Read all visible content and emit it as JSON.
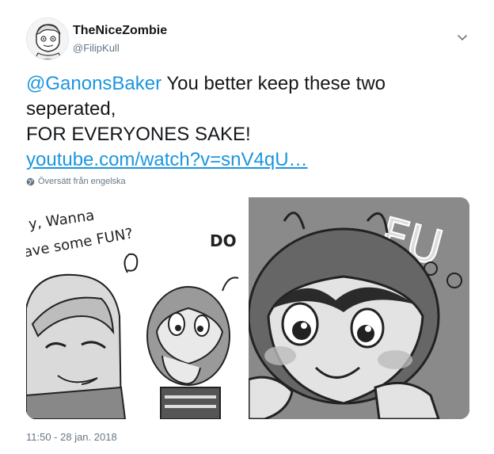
{
  "author": {
    "display_name": "TheNiceZombie",
    "handle": "@FilipKull",
    "avatar_icon": "zombie-cartoon-avatar"
  },
  "tweet": {
    "mention": "@GanonsBaker",
    "text_part1": " You better keep these two seperated,",
    "text_part2": "FOR EVERYONES SAKE!",
    "link": "youtube.com/watch?v=snV4qU…"
  },
  "translate": {
    "label": "Översätt från engelska",
    "icon": "globe-icon"
  },
  "media": {
    "left_caption_line1": "y, Wanna",
    "left_caption_line2": "ave some FUN?",
    "left_caption_do": "DO",
    "right_caption": "FU"
  },
  "timestamp": "11:50 - 28 jan. 2018",
  "colors": {
    "link": "#1b95e0",
    "secondary_text": "#657786",
    "primary_text": "#14171a"
  }
}
